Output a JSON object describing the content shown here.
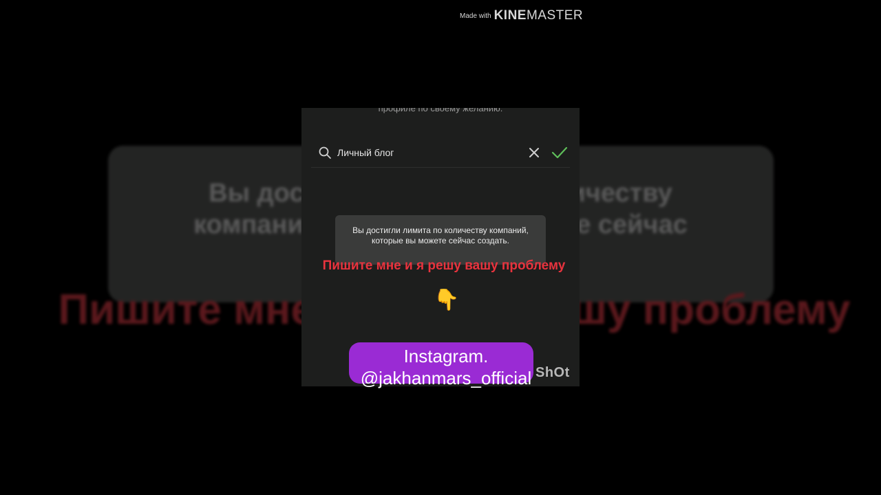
{
  "watermark": {
    "made_with": "Made with",
    "brand_bold": "KINE",
    "brand_light": "MASTER"
  },
  "background": {
    "toast_text": "Вы достигли лимита по количеству компаний, которые вы можете сейчас",
    "red_text": "Пишите мне и я решу вашу проблему"
  },
  "screen": {
    "top_cut_text": "профиле по своему желанию.",
    "search": {
      "value": "Личный блог",
      "icon": "search-icon",
      "clear_icon": "close-icon",
      "confirm_icon": "check-icon"
    },
    "toast": {
      "text": "Вы достигли лимита по количеству компаний, которые вы можете сейчас создать."
    },
    "caption": "Пишите мне и я решу вашу проблему",
    "hand_emoji": "👇",
    "shot_mark": "ShOt"
  },
  "instagram": {
    "line1": "Instagram.",
    "line2": "@jakhanmars_official",
    "pill_color": "#9a2bd4"
  },
  "colors": {
    "caption_red": "#e8333e",
    "check_green": "#5fbf5a"
  }
}
